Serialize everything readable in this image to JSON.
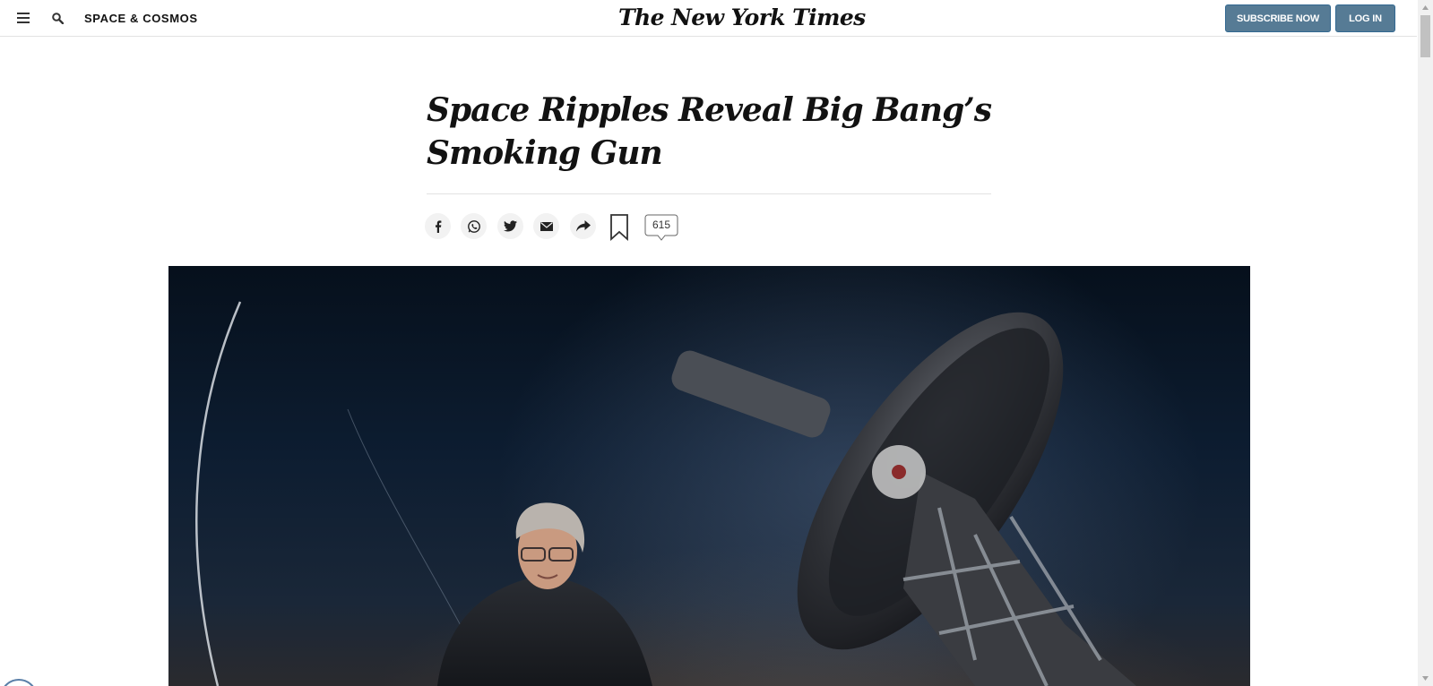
{
  "header": {
    "menu_icon": "hamburger-menu-icon",
    "search_icon": "search-icon",
    "section": "SPACE & COSMOS",
    "logo": "The New York Times",
    "subscribe_label": "SUBSCRIBE NOW",
    "login_label": "LOG IN",
    "button_color": "#567b95"
  },
  "article": {
    "headline": "Space Ripples Reveal Big Bang’s Smoking Gun"
  },
  "share_tools": {
    "items": [
      "facebook-icon",
      "whatsapp-icon",
      "twitter-icon",
      "email-icon",
      "share-icon"
    ],
    "save_icon": "bookmark-icon",
    "comment_count": "615"
  },
  "hero": {
    "image": "photo of a man in a dark jacket standing in front of a large telescope at night"
  }
}
